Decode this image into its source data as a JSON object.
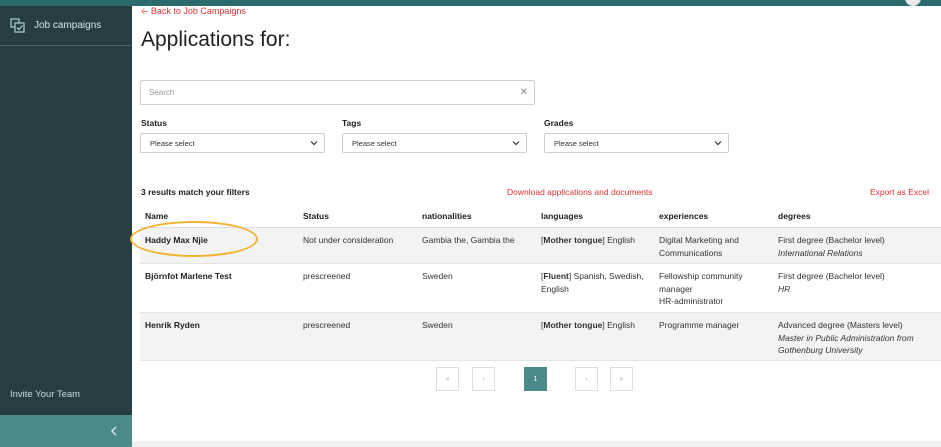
{
  "colors": {
    "sidebar_bg": "#263e3f",
    "accent": "#4c8a8a",
    "link_red": "#d33",
    "highlight": "#f1b22f"
  },
  "sidebar": {
    "items": [
      {
        "label": "Job campaigns",
        "icon": "job-campaigns-icon"
      }
    ],
    "invite_label": "Invite Your Team",
    "collapse_icon": "chevron-left-icon"
  },
  "header": {
    "back_label": "Back to Job Campaigns",
    "back_icon": "arrow-left-icon",
    "title": "Applications for:"
  },
  "search": {
    "placeholder": "Search",
    "value": "",
    "clear_icon": "close-icon"
  },
  "filters": [
    {
      "label": "Status",
      "selected": "Please select"
    },
    {
      "label": "Tags",
      "selected": "Please select"
    },
    {
      "label": "Grades",
      "selected": "Please select"
    }
  ],
  "results": {
    "count_text": "3 results match your filters",
    "download_label": "Download applications and documents",
    "export_label": "Export as Excel"
  },
  "table": {
    "columns": [
      "Name",
      "Status",
      "nationalities",
      "languages",
      "experiences",
      "degrees"
    ],
    "rows": [
      {
        "name": "Haddy Max Njie",
        "status": "Not under consideration",
        "nationalities": "Gambia the, Gambia the",
        "languages": {
          "level": "Mother tongue",
          "list": "English"
        },
        "experiences": [
          "Digital Marketing and",
          "Communications"
        ],
        "degree_level": "First degree (Bachelor level)",
        "degree_subject": "International Relations"
      },
      {
        "name": "Björnfot Marlene Test",
        "status": "prescreened",
        "nationalities": "Sweden",
        "languages": {
          "level": "Fluent",
          "list": "Spanish, Swedish,",
          "list2": "English"
        },
        "experiences": [
          "Fellowship community",
          "manager",
          "HR-administrator"
        ],
        "degree_level": "First degree (Bachelor level)",
        "degree_subject": "HR"
      },
      {
        "name": "Henrik Ryden",
        "status": "prescreened",
        "nationalities": "Sweden",
        "languages": {
          "level": "Mother tongue",
          "list": "English"
        },
        "experiences": [
          "Programme manager"
        ],
        "degree_level": "Advanced degree (Masters level)",
        "degree_subject": "Master in Public Administration from",
        "degree_subject2": "Gothenburg University"
      }
    ]
  },
  "pagination": {
    "first": "«",
    "prev": "‹",
    "current": "1",
    "next": "›",
    "last": "»"
  }
}
